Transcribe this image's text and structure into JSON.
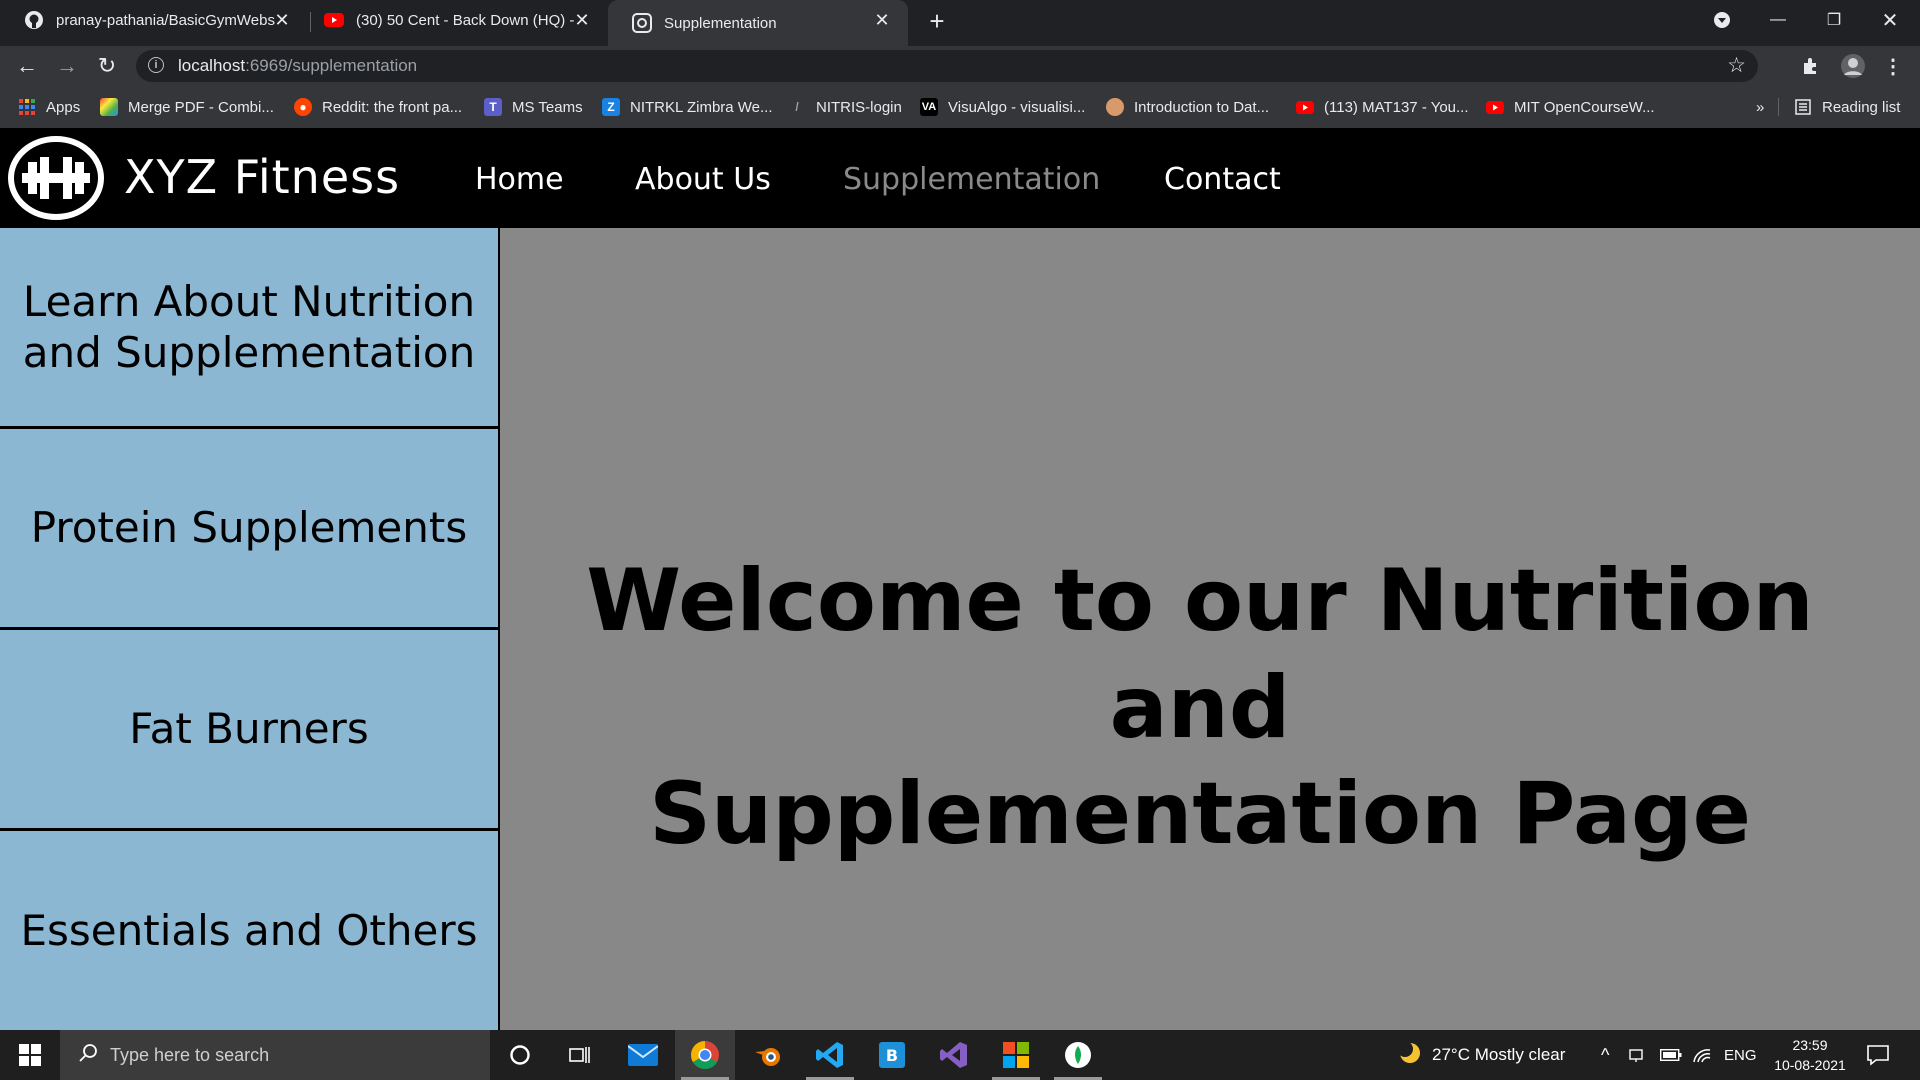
{
  "browser": {
    "tabs": [
      {
        "title": "pranay-pathania/BasicGymWebsi",
        "icon": "github-icon",
        "active": false
      },
      {
        "title": "(30) 50 Cent - Back Down (HQ) -",
        "icon": "youtube-icon",
        "active": false
      },
      {
        "title": "Supplementation",
        "icon": "site-favicon-icon",
        "active": true
      }
    ],
    "url_host": "localhost",
    "url_rest": ":6969/supplementation",
    "bookmarks": [
      {
        "label": "Apps",
        "icon": "apps-grid-icon"
      },
      {
        "label": "Merge PDF - Combi...",
        "icon": "merge-pdf-icon"
      },
      {
        "label": "Reddit: the front pa...",
        "icon": "reddit-icon"
      },
      {
        "label": "MS Teams",
        "icon": "teams-icon"
      },
      {
        "label": "NITRKL Zimbra We...",
        "icon": "zimbra-icon"
      },
      {
        "label": "NITRIS-login",
        "icon": "nitris-icon"
      },
      {
        "label": "VisuAlgo - visualisi...",
        "icon": "visualgo-icon"
      },
      {
        "label": "Introduction to Dat...",
        "icon": "avatar-icon"
      },
      {
        "label": "(113) MAT137 - You...",
        "icon": "youtube-icon"
      },
      {
        "label": "MIT OpenCourseW...",
        "icon": "youtube-icon"
      }
    ],
    "overflow_label": "»",
    "reading_list": "Reading list"
  },
  "site": {
    "brand": "XYZ Fitness",
    "nav": [
      {
        "label": "Home",
        "current": false
      },
      {
        "label": "About Us",
        "current": false
      },
      {
        "label": "Supplementation",
        "current": true
      },
      {
        "label": "Contact",
        "current": false
      }
    ],
    "sidebar": [
      {
        "label": "Learn About Nutrition and Supplementation"
      },
      {
        "label": "Protein Supplements"
      },
      {
        "label": "Fat Burners"
      },
      {
        "label": "Essentials and Others"
      }
    ],
    "welcome_line1": "Welcome to our Nutrition and",
    "welcome_line2": "Supplementation Page"
  },
  "taskbar": {
    "search_placeholder": "Type here to search",
    "apps": [
      "cortana-icon",
      "task-view-icon",
      "mail-icon",
      "chrome-icon",
      "blender-icon",
      "vscode-icon",
      "bing-icon",
      "visual-studio-icon",
      "office-icon",
      "mongodb-icon"
    ],
    "weather": "27°C  Mostly clear",
    "language": "ENG",
    "time": "23:59",
    "date": "10-08-2021"
  },
  "colors": {
    "sidebar_bg": "#8bb7d3",
    "main_bg": "#888888",
    "nav_current": "#8a8a8a"
  }
}
